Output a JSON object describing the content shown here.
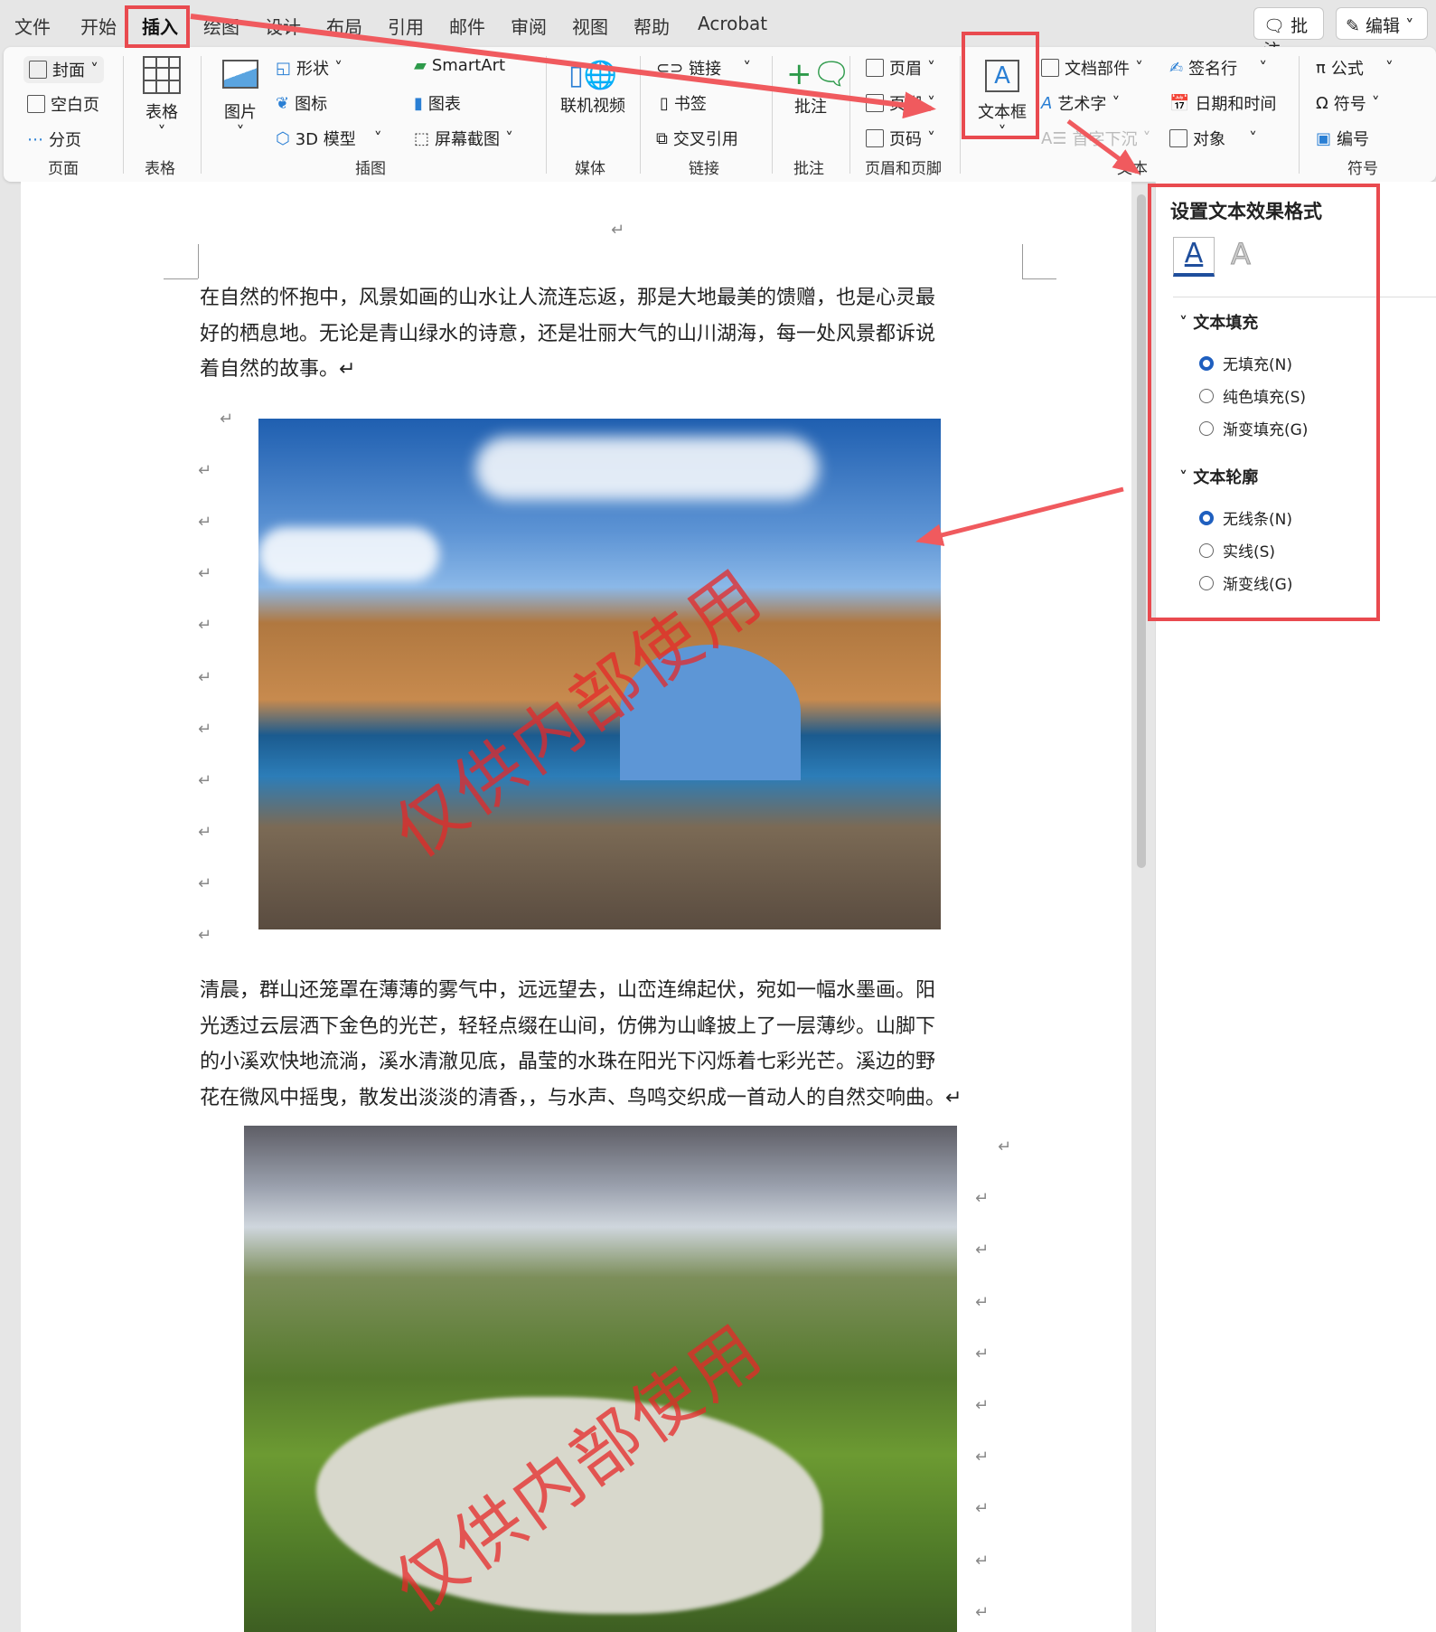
{
  "menu": {
    "tabs": [
      "文件",
      "开始",
      "插入",
      "绘图",
      "设计",
      "布局",
      "引用",
      "邮件",
      "审阅",
      "视图",
      "帮助",
      "Acrobat"
    ],
    "comment_btn": "批注",
    "edit_btn": "编辑"
  },
  "ribbon": {
    "pages": {
      "cover": "封面",
      "blank": "空白页",
      "break": "分页",
      "group": "页面"
    },
    "table": {
      "label": "表格",
      "group": "表格"
    },
    "illus": {
      "picture": "图片",
      "shapes": "形状",
      "icons": "图标",
      "model3d": "3D 模型",
      "smartart": "SmartArt",
      "chart": "图表",
      "screenshot": "屏幕截图",
      "group": "插图"
    },
    "media": {
      "video": "联机视频",
      "group": "媒体"
    },
    "links": {
      "link": "链接",
      "bookmark": "书签",
      "crossref": "交叉引用",
      "group": "链接"
    },
    "comments": {
      "comment": "批注",
      "group": "批注"
    },
    "hf": {
      "header": "页眉",
      "footer": "页脚",
      "pagenum": "页码",
      "group": "页眉和页脚"
    },
    "text": {
      "textbox": "文本框",
      "parts": "文档部件",
      "wordart": "艺术字",
      "dropcap": "首字下沉",
      "signature": "签名行",
      "datetime": "日期和时间",
      "object": "对象",
      "group": "文本"
    },
    "symbols": {
      "equation": "公式",
      "symbol": "符号",
      "number": "编号",
      "group": "符号"
    }
  },
  "document": {
    "para1": [
      "在自然的怀抱中，风景如画的山水让人流连忘返，那是大地最美的馈赠，也是心灵最",
      "好的栖息地。无论是青山绿水的诗意，还是壮丽大气的山川湖海，每一处风景都诉说",
      "着自然的故事。↵"
    ],
    "para2": [
      "清晨，群山还笼罩在薄薄的雾气中，远远望去，山峦连绵起伏，宛如一幅水墨画。阳",
      "光透过云层洒下金色的光芒，轻轻点缀在山间，仿佛为山峰披上了一层薄纱。山脚下",
      "的小溪欢快地流淌，溪水清澈见底，晶莹的水珠在阳光下闪烁着七彩光芒。溪边的野",
      "花在微风中摇曳，散发出淡淡的清香，，与水声、鸟鸣交织成一首动人的自然交响曲。↵"
    ],
    "watermark": "仅供内部使用",
    "return_mark": "↵"
  },
  "pane": {
    "title": "设置文本效果格式",
    "fill_section": "文本填充",
    "fill_options": [
      "无填充(N)",
      "纯色填充(S)",
      "渐变填充(G)"
    ],
    "outline_section": "文本轮廓",
    "outline_options": [
      "无线条(N)",
      "实线(S)",
      "渐变线(G)"
    ]
  },
  "colors": {
    "annotation_red": "#e94a4f",
    "accent_blue": "#1f5fbf"
  }
}
